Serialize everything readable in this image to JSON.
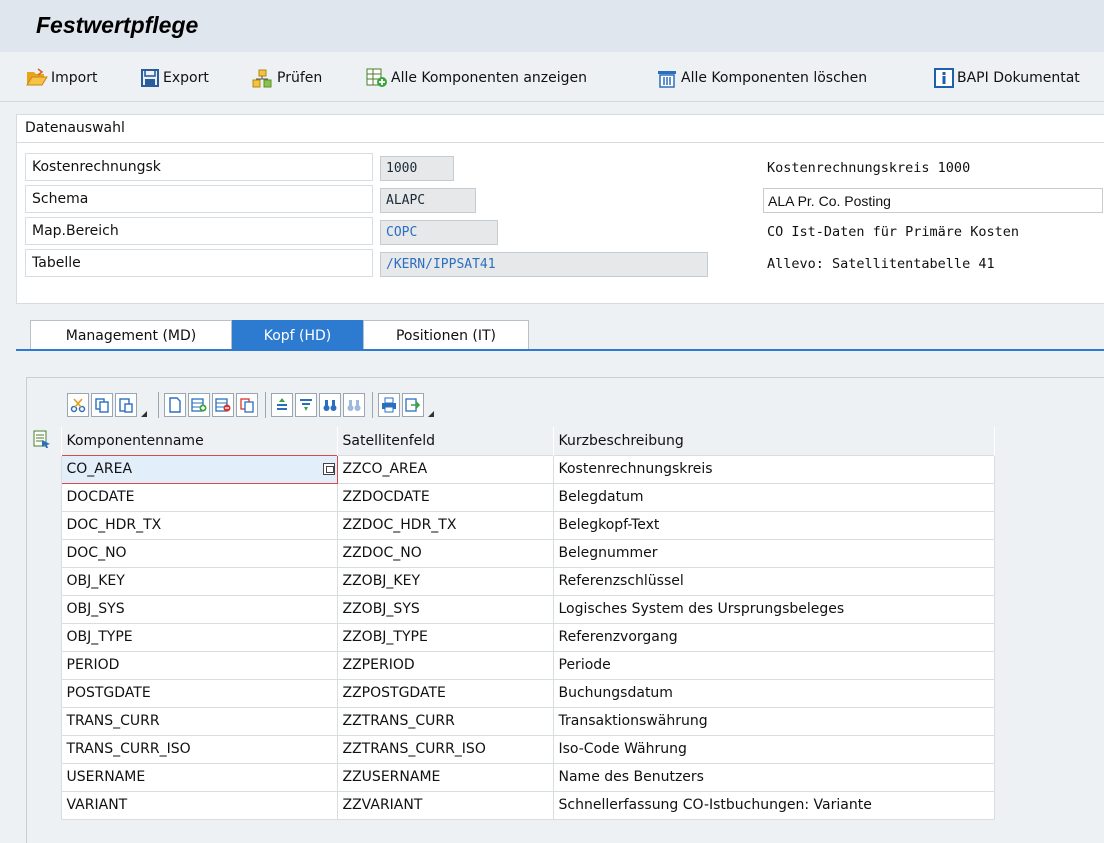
{
  "title": "Festwertpflege",
  "toolbar": {
    "import": "Import",
    "export": "Export",
    "pruefen": "Prüfen",
    "show_all": "Alle Komponenten anzeigen",
    "delete_all": "Alle Komponenten löschen",
    "bapi": "BAPI Dokumentat"
  },
  "panel": {
    "header": "Datenauswahl",
    "rows": [
      {
        "label": "Kostenrechnungsk",
        "value": "1000",
        "desc": "Kostenrechnungskreis 1000"
      },
      {
        "label": "Schema",
        "value": "ALAPC",
        "desc": "ALA Pr. Co. Posting"
      },
      {
        "label": "Map.Bereich",
        "value": "COPC",
        "desc": "CO Ist-Daten für Primäre Kosten"
      },
      {
        "label": "Tabelle",
        "value": "/KERN/IPPSAT41",
        "desc": "Allevo: Satellitentabelle 41"
      }
    ]
  },
  "tabs": [
    "Management (MD)",
    "Kopf (HD)",
    "Positionen (IT)"
  ],
  "grid": {
    "columns": [
      "Komponentenname",
      "Satellitenfeld",
      "Kurzbeschreibung"
    ],
    "rows": [
      [
        "CO_AREA",
        "ZZCO_AREA",
        "Kostenrechnungskreis"
      ],
      [
        "DOCDATE",
        "ZZDOCDATE",
        "Belegdatum"
      ],
      [
        "DOC_HDR_TX",
        "ZZDOC_HDR_TX",
        "Belegkopf-Text"
      ],
      [
        "DOC_NO",
        "ZZDOC_NO",
        "Belegnummer"
      ],
      [
        "OBJ_KEY",
        "ZZOBJ_KEY",
        "Referenzschlüssel"
      ],
      [
        "OBJ_SYS",
        "ZZOBJ_SYS",
        "Logisches System des Ursprungsbeleges"
      ],
      [
        "OBJ_TYPE",
        "ZZOBJ_TYPE",
        "Referenzvorgang"
      ],
      [
        "PERIOD",
        "ZZPERIOD",
        "Periode"
      ],
      [
        "POSTGDATE",
        "ZZPOSTGDATE",
        "Buchungsdatum"
      ],
      [
        "TRANS_CURR",
        "ZZTRANS_CURR",
        "Transaktionswährung"
      ],
      [
        "TRANS_CURR_ISO",
        "ZZTRANS_CURR_ISO",
        "Iso-Code Währung"
      ],
      [
        "USERNAME",
        "ZZUSERNAME",
        "Name des Benutzers"
      ],
      [
        "VARIANT",
        "ZZVARIANT",
        "Schnellerfassung CO-Istbuchungen: Variante"
      ]
    ]
  }
}
